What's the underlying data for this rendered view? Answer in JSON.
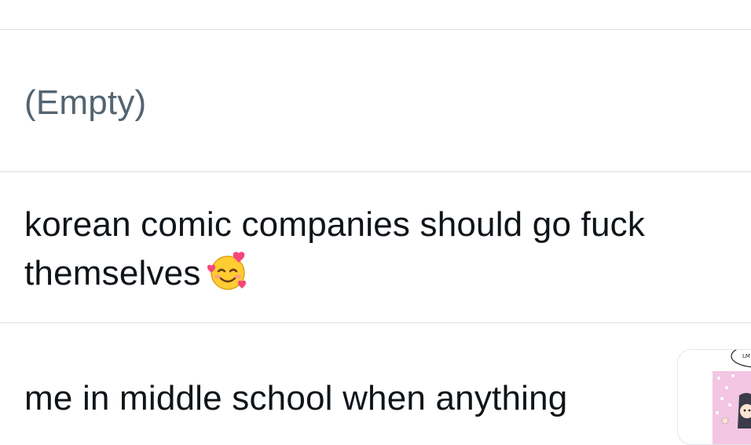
{
  "feed": {
    "items": [
      {
        "text": "(Empty)",
        "kind": "empty"
      },
      {
        "text_line1": "korean comic companies should go fuck",
        "text_line2": "themselves",
        "emoji": "smiling-face-with-hearts-emoji"
      },
      {
        "text": "me in middle school when anything",
        "thumbnail": "comic-thumbnail"
      }
    ]
  },
  "colors": {
    "text": "#0f1419",
    "muted_text": "#536471",
    "divider": "#dbe0e3",
    "emoji_face": "#ffcc33",
    "emoji_heart": "#f5467a"
  }
}
